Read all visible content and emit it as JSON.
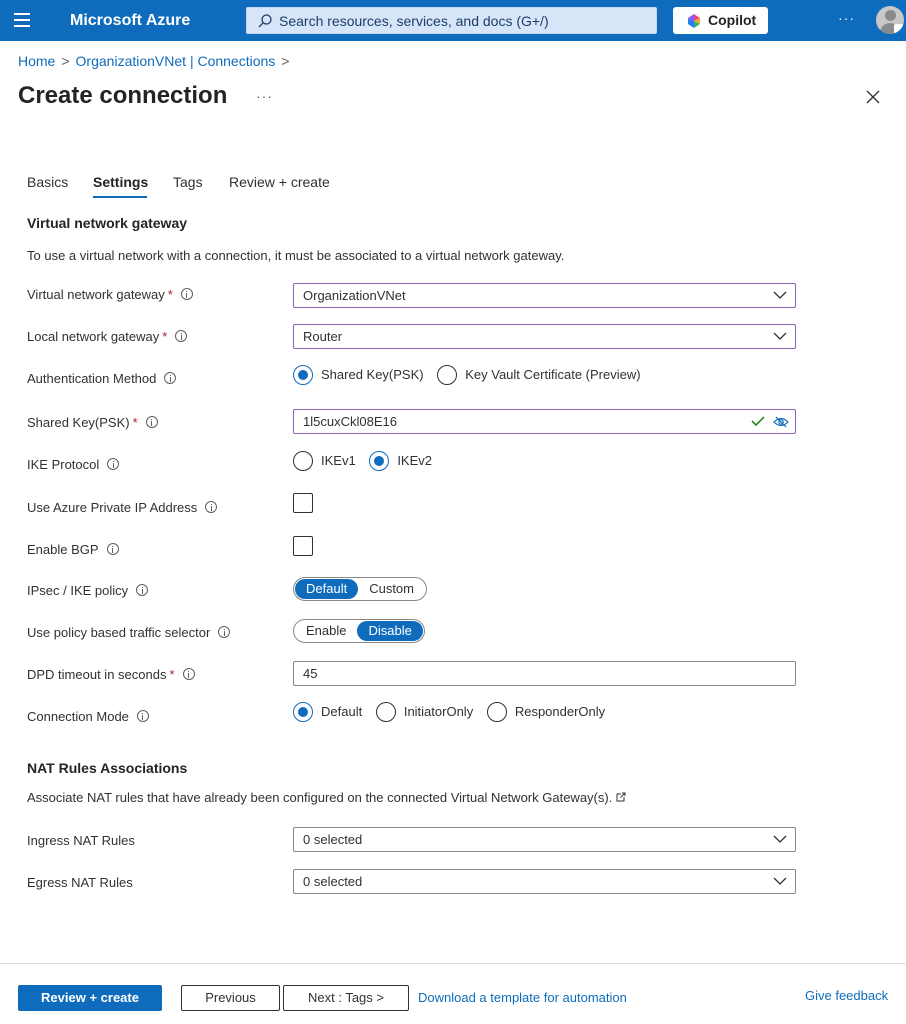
{
  "topbar": {
    "brand": "Microsoft Azure",
    "search_placeholder": "Search resources, services, and docs (G+/)",
    "copilot_label": "Copilot",
    "more": "···"
  },
  "breadcrumb": {
    "home": "Home",
    "parent": "OrganizationVNet | Connections",
    "sep": ">"
  },
  "page": {
    "title": "Create connection",
    "more": "···"
  },
  "tabs": [
    {
      "label": "Basics",
      "active": false
    },
    {
      "label": "Settings",
      "active": true
    },
    {
      "label": "Tags",
      "active": false
    },
    {
      "label": "Review + create",
      "active": false
    }
  ],
  "gateway_section": {
    "title": "Virtual network gateway",
    "description": "To use a virtual network with a connection, it must be associated to a virtual network gateway."
  },
  "fields": {
    "vng": {
      "label": "Virtual network gateway",
      "required": "*",
      "value": "OrganizationVNet"
    },
    "lng": {
      "label": "Local network gateway",
      "required": "*",
      "value": "Router"
    },
    "auth": {
      "label": "Authentication Method",
      "options": [
        "Shared Key(PSK)",
        "Key Vault Certificate (Preview)"
      ],
      "selected": "Shared Key(PSK)"
    },
    "psk": {
      "label": "Shared Key(PSK)",
      "required": "*",
      "value": "1l5cuxCkl08E16"
    },
    "ike": {
      "label": "IKE Protocol",
      "options": [
        "IKEv1",
        "IKEv2"
      ],
      "selected": "IKEv2"
    },
    "private_ip": {
      "label": "Use Azure Private IP Address",
      "checked": false
    },
    "bgp": {
      "label": "Enable BGP",
      "checked": false
    },
    "ipsec": {
      "label": "IPsec / IKE policy",
      "options": [
        "Default",
        "Custom"
      ],
      "selected": "Default"
    },
    "policy_selector": {
      "label": "Use policy based traffic selector",
      "options": [
        "Enable",
        "Disable"
      ],
      "selected": "Disable"
    },
    "dpd": {
      "label": "DPD timeout in seconds",
      "required": "*",
      "value": "45"
    },
    "mode": {
      "label": "Connection Mode",
      "options": [
        "Default",
        "InitiatorOnly",
        "ResponderOnly"
      ],
      "selected": "Default"
    }
  },
  "nat_section": {
    "title": "NAT Rules Associations",
    "description": "Associate NAT rules that have already been configured on the connected Virtual Network Gateway(s).",
    "ingress": {
      "label": "Ingress NAT Rules",
      "value": "0 selected"
    },
    "egress": {
      "label": "Egress NAT Rules",
      "value": "0 selected"
    }
  },
  "footer": {
    "review_create": "Review + create",
    "previous": "Previous",
    "next": "Next : Tags >",
    "download_template": "Download a template for automation",
    "feedback": "Give feedback"
  },
  "colors": {
    "accent": "#0f6cbd",
    "required": "#a4262c",
    "focus_border": "#8764b8",
    "valid_check": "#107c10"
  }
}
